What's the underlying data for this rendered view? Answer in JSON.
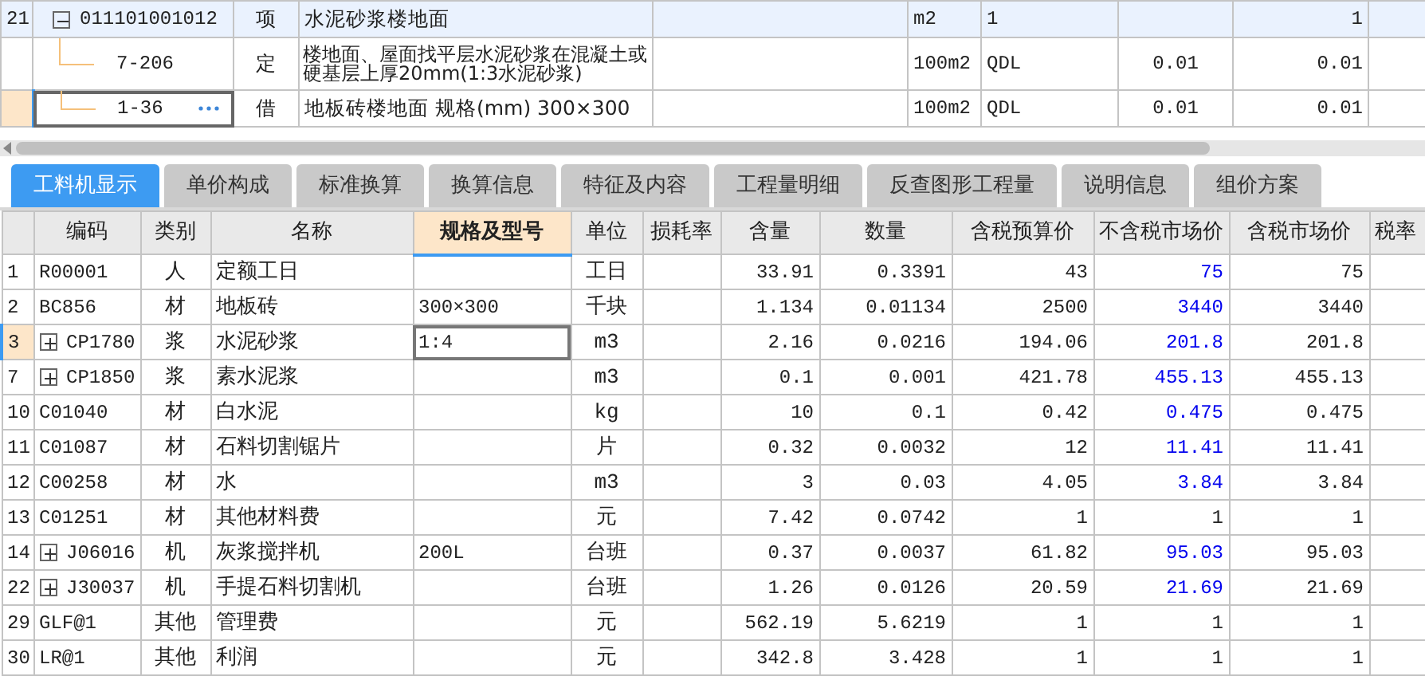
{
  "upper_table": {
    "rows": [
      {
        "kind": "list_item",
        "number": "21",
        "code": "011101001012",
        "expanded": true,
        "type": "项",
        "name": "水泥砂浆楼地面",
        "unit": "m2",
        "column_7": "1",
        "column_9": "1",
        "selected": false
      },
      {
        "kind": "quota",
        "code": "7-206",
        "type": "定",
        "name": "楼地面、屋面找平层水泥砂浆在混凝土或硬基层上厚20mm(1:3水泥砂浆)",
        "unit": "100m2",
        "column_7": "QDL",
        "column_8": "0.01",
        "column_9": "0.01",
        "selected": false
      },
      {
        "kind": "quota",
        "code": "1-36",
        "type": "借",
        "name": "地板砖楼地面 规格(mm) 300×300",
        "unit": "100m2",
        "column_7": "QDL",
        "column_8": "0.01",
        "column_9": "0.01",
        "selected": true
      }
    ]
  },
  "tabs": [
    {
      "label": "工料机显示",
      "selected": true
    },
    {
      "label": "单价构成",
      "selected": false
    },
    {
      "label": "标准换算",
      "selected": false
    },
    {
      "label": "换算信息",
      "selected": false
    },
    {
      "label": "特征及内容",
      "selected": false
    },
    {
      "label": "工程量明细",
      "selected": false
    },
    {
      "label": "反查图形工程量",
      "selected": false
    },
    {
      "label": "说明信息",
      "selected": false
    },
    {
      "label": "组价方案",
      "selected": false
    }
  ],
  "resource_table": {
    "columns": [
      {
        "label": "编码",
        "selected": false
      },
      {
        "label": "类别",
        "selected": false
      },
      {
        "label": "名称",
        "selected": false
      },
      {
        "label": "规格及型号",
        "selected": true
      },
      {
        "label": "单位",
        "selected": false
      },
      {
        "label": "损耗率",
        "selected": false
      },
      {
        "label": "含量",
        "selected": false
      },
      {
        "label": "数量",
        "selected": false
      },
      {
        "label": "含税预算价",
        "selected": false
      },
      {
        "label": "不含税市场价",
        "selected": false
      },
      {
        "label": "含税市场价",
        "selected": false
      },
      {
        "label": "税率",
        "selected": false
      }
    ],
    "rows": [
      {
        "number": "1",
        "code": "R00001",
        "expandable": false,
        "type": "人",
        "name": "定额工日",
        "unit": "工日",
        "content": "33.91",
        "quantity": "0.3391",
        "budget_price": "43",
        "market_price_ex_tax": "75",
        "price_adjusted": true,
        "market_price": "75",
        "selected": false
      },
      {
        "number": "2",
        "code": "BC856",
        "expandable": false,
        "type": "材",
        "name": "地板砖",
        "spec": "300×300",
        "unit": "千块",
        "content": "1.134",
        "quantity": "0.01134",
        "budget_price": "2500",
        "market_price_ex_tax": "3440",
        "price_adjusted": true,
        "market_price": "3440",
        "selected": false
      },
      {
        "number": "3",
        "code": "CP1780",
        "expandable": true,
        "type": "浆",
        "name": "水泥砂浆",
        "spec": "1:4",
        "unit": "m3",
        "content": "2.16",
        "quantity": "0.0216",
        "budget_price": "194.06",
        "market_price_ex_tax": "201.8",
        "price_adjusted": true,
        "market_price": "201.8",
        "selected": true
      },
      {
        "number": "7",
        "code": "CP1850",
        "expandable": true,
        "type": "浆",
        "name": "素水泥浆",
        "unit": "m3",
        "content": "0.1",
        "quantity": "0.001",
        "budget_price": "421.78",
        "market_price_ex_tax": "455.13",
        "price_adjusted": true,
        "market_price": "455.13",
        "selected": false
      },
      {
        "number": "10",
        "code": "C01040",
        "expandable": false,
        "type": "材",
        "name": "白水泥",
        "unit": "kg",
        "content": "10",
        "quantity": "0.1",
        "budget_price": "0.42",
        "market_price_ex_tax": "0.475",
        "price_adjusted": true,
        "market_price": "0.475",
        "selected": false
      },
      {
        "number": "11",
        "code": "C01087",
        "expandable": false,
        "type": "材",
        "name": "石料切割锯片",
        "unit": "片",
        "content": "0.32",
        "quantity": "0.0032",
        "budget_price": "12",
        "market_price_ex_tax": "11.41",
        "price_adjusted": true,
        "market_price": "11.41",
        "selected": false
      },
      {
        "number": "12",
        "code": "C00258",
        "expandable": false,
        "type": "材",
        "name": "水",
        "unit": "m3",
        "content": "3",
        "quantity": "0.03",
        "budget_price": "4.05",
        "market_price_ex_tax": "3.84",
        "price_adjusted": true,
        "market_price": "3.84",
        "selected": false
      },
      {
        "number": "13",
        "code": "C01251",
        "expandable": false,
        "type": "材",
        "name": "其他材料费",
        "unit": "元",
        "content": "7.42",
        "quantity": "0.0742",
        "budget_price": "1",
        "market_price_ex_tax": "1",
        "price_adjusted": false,
        "market_price": "1",
        "selected": false
      },
      {
        "number": "14",
        "code": "J06016",
        "expandable": true,
        "type": "机",
        "name": "灰浆搅拌机",
        "spec": "200L",
        "unit": "台班",
        "content": "0.37",
        "quantity": "0.0037",
        "budget_price": "61.82",
        "market_price_ex_tax": "95.03",
        "price_adjusted": true,
        "market_price": "95.03",
        "selected": false
      },
      {
        "number": "22",
        "code": "J30037",
        "expandable": true,
        "type": "机",
        "name": "手提石料切割机",
        "unit": "台班",
        "content": "1.26",
        "quantity": "0.0126",
        "budget_price": "20.59",
        "market_price_ex_tax": "21.69",
        "price_adjusted": true,
        "market_price": "21.69",
        "selected": false
      },
      {
        "number": "29",
        "code": "GLF@1",
        "expandable": false,
        "type": "其他",
        "name": "管理费",
        "unit": "元",
        "content": "562.19",
        "quantity": "5.6219",
        "budget_price": "1",
        "market_price_ex_tax": "1",
        "price_adjusted": false,
        "market_price": "1",
        "selected": false
      },
      {
        "number": "30",
        "code": "LR@1",
        "expandable": false,
        "type": "其他",
        "name": "利润",
        "unit": "元",
        "content": "342.8",
        "quantity": "3.428",
        "budget_price": "1",
        "market_price_ex_tax": "1",
        "price_adjusted": false,
        "market_price": "1",
        "selected": false
      }
    ]
  }
}
